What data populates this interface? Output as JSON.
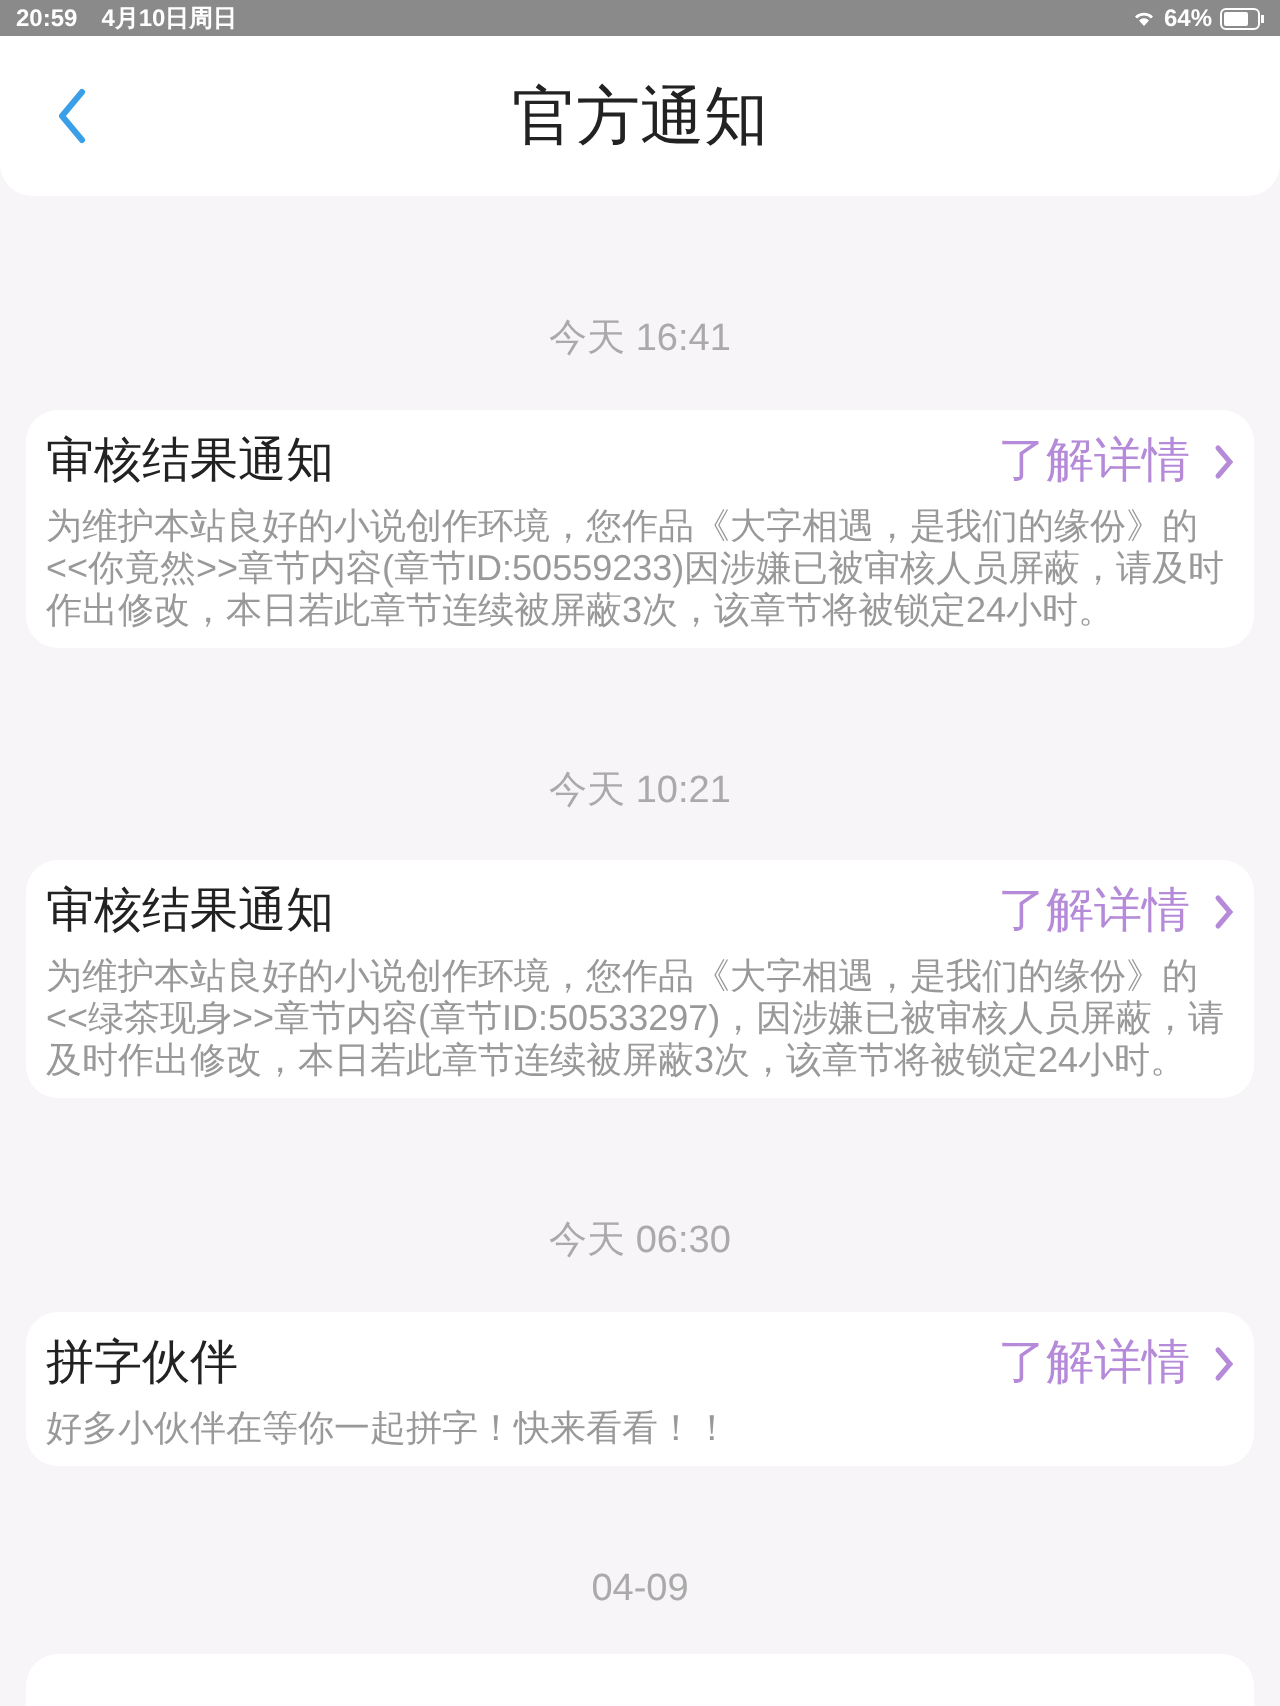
{
  "status_bar": {
    "time": "20:59",
    "date": "4月10日周日",
    "battery": "64%"
  },
  "header": {
    "title": "官方通知"
  },
  "notices": [
    {
      "timestamp": "今天 16:41",
      "title": "审核结果通知",
      "link": "了解详情",
      "body": "为维护本站良好的小说创作环境，您作品《大字相遇，是我们的缘份》的<<你竟然>>章节内容(章节ID:50559233)因涉嫌已被审核人员屏蔽，请及时作出修改，本日若此章节连续被屏蔽3次，该章节将被锁定24小时。"
    },
    {
      "timestamp": "今天 10:21",
      "title": "审核结果通知",
      "link": "了解详情",
      "body": "为维护本站良好的小说创作环境，您作品《大字相遇，是我们的缘份》的<<绿茶现身>>章节内容(章节ID:50533297)，因涉嫌已被审核人员屏蔽，请及时作出修改，本日若此章节连续被屏蔽3次，该章节将被锁定24小时。"
    },
    {
      "timestamp": "今天 06:30",
      "title": "拼字伙伴",
      "link": "了解详情",
      "body": "好多小伙伴在等你一起拼字！快来看看！！"
    }
  ],
  "trailing_timestamp": "04-09"
}
